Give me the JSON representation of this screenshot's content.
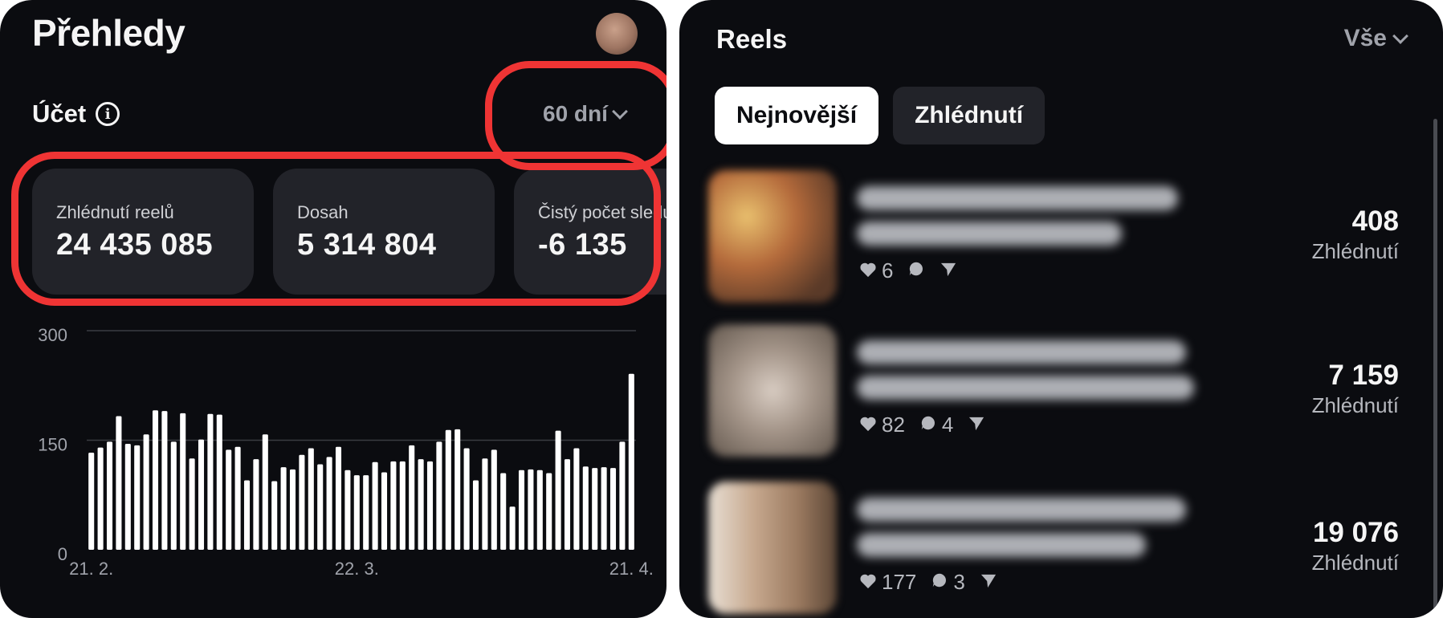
{
  "header": {
    "title": "Přehledy"
  },
  "account": {
    "label": "Účet",
    "period": "60 dní"
  },
  "cards": [
    {
      "label": "Zhlédnutí reelů",
      "value": "24 435 085"
    },
    {
      "label": "Dosah",
      "value": "5 314 804"
    },
    {
      "label": "Čistý počet sledujících",
      "value": "-6 135"
    }
  ],
  "chart_data": {
    "type": "bar",
    "title": "",
    "xlabel": "",
    "ylabel": "",
    "ylim": [
      0,
      300
    ],
    "y_ticks": [
      "300",
      "150",
      "0"
    ],
    "x_tick_labels": [
      "21. 2.",
      "22. 3.",
      "21. 4."
    ],
    "grid": true,
    "values": [
      133,
      140,
      148,
      183,
      145,
      143,
      158,
      191,
      190,
      148,
      187,
      125,
      151,
      186,
      185,
      137,
      141,
      95,
      124,
      158,
      94,
      113,
      110,
      130,
      139,
      117,
      127,
      141,
      109,
      102,
      102,
      120,
      106,
      121,
      121,
      143,
      124,
      121,
      148,
      164,
      165,
      139,
      95,
      125,
      137,
      105,
      59,
      109,
      110,
      109,
      105,
      163,
      124,
      139,
      114,
      112,
      113,
      112,
      148,
      241
    ],
    "colors": {
      "bar": "#ffffff",
      "grid": "#3a3c42",
      "tick": "#a0a3ab"
    }
  },
  "reels": {
    "title": "Reels",
    "filter": "Vše",
    "tabs": [
      "Nejnovější",
      "Zhlédnutí"
    ],
    "items": [
      {
        "likes": "6",
        "comments": "",
        "views": "408",
        "views_label": "Zhlédnutí"
      },
      {
        "likes": "82",
        "comments": "4",
        "views": "7 159",
        "views_label": "Zhlédnutí"
      },
      {
        "likes": "177",
        "comments": "3",
        "views": "19 076",
        "views_label": "Zhlédnutí"
      }
    ]
  },
  "colors": {
    "background": "#0b0c10",
    "card": "#222329",
    "highlight": "#ef3434",
    "muted": "#a0a3ab"
  }
}
